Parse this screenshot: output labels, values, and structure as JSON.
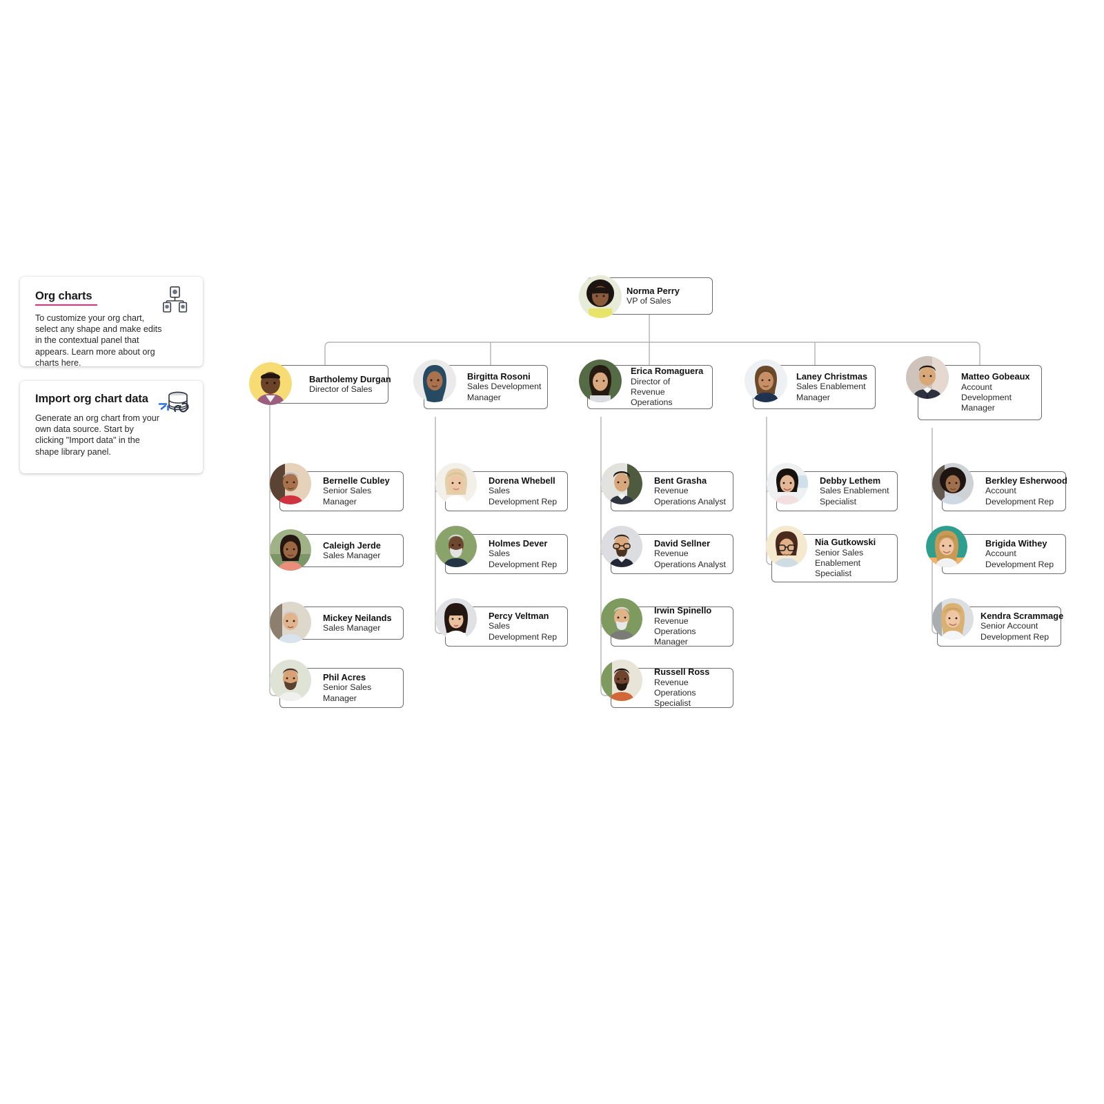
{
  "panel": {
    "cards": [
      {
        "id": "org-charts",
        "title": "Org charts",
        "body": "To customize your org chart, select any shape and make edits in the contextual panel that appears. Learn more about org charts here.",
        "icon": "org-chart-icon"
      },
      {
        "id": "import-org-chart-data",
        "title": "Import org chart data",
        "body": "Generate an org chart from your own data source. Start by clicking \"Import data\" in the shape library panel.",
        "icon": "database-link-icon"
      }
    ],
    "accent_color": "#ec2b7b"
  },
  "chart_data": {
    "type": "diagram",
    "title": "Sales org chart",
    "node_border_color": "#6b6b6b",
    "connector_color": "#b4b4b4",
    "root": {
      "id": "norma-perry",
      "name": "Norma Perry",
      "title": "VP of Sales",
      "avatar": "woman-curly-dark-hair"
    },
    "columns": [
      {
        "manager": {
          "id": "bartholemy-durgan",
          "name": "Bartholemy Durgan",
          "title": "Director of Sales",
          "avatar": "man-yellow-bg"
        },
        "reports": [
          {
            "id": "bernelle-cubley",
            "name": "Bernelle Cubley",
            "title": "Senior Sales Manager",
            "avatar": "woman-grey-hair-red-top"
          },
          {
            "id": "caleigh-jerde",
            "name": "Caleigh Jerde",
            "title": "Sales Manager",
            "avatar": "woman-outdoors-pink-top"
          },
          {
            "id": "mickey-neilands",
            "name": "Mickey Neilands",
            "title": "Sales Manager",
            "avatar": "man-white-hair-blue-shirt"
          },
          {
            "id": "phil-acres",
            "name": "Phil Acres",
            "title": "Senior Sales Manager",
            "avatar": "man-beard-white-shirt"
          }
        ]
      },
      {
        "manager": {
          "id": "birgitta-rosoni",
          "name": "Birgitta Rosoni",
          "title": "Sales Development Manager",
          "avatar": "woman-navy-hijab"
        },
        "reports": [
          {
            "id": "dorena-whebell",
            "name": "Dorena Whebell",
            "title": "Sales Development Rep",
            "avatar": "woman-blonde-bob"
          },
          {
            "id": "holmes-dever",
            "name": "Holmes Dever",
            "title": "Sales Development Rep",
            "avatar": "man-white-beard-navy"
          },
          {
            "id": "percy-veltman",
            "name": "Percy Veltman",
            "title": "Sales Development Rep",
            "avatar": "woman-dark-bangs"
          }
        ]
      },
      {
        "manager": {
          "id": "erica-romaguera",
          "name": "Erica Romaguera",
          "title": "Director of Revenue Operations",
          "avatar": "woman-dark-hair-green-bg"
        },
        "reports": [
          {
            "id": "bent-grasha",
            "name": "Bent Grasha",
            "title": "Revenue Operations Analyst",
            "avatar": "man-dark-hair-suit"
          },
          {
            "id": "david-sellner",
            "name": "David Sellner",
            "title": "Revenue Operations Analyst",
            "avatar": "man-glasses-beard-suit"
          },
          {
            "id": "irwin-spinello",
            "name": "Irwin Spinello",
            "title": "Revenue Operations Manager",
            "avatar": "man-grey-beard-outdoors"
          },
          {
            "id": "russell-ross",
            "name": "Russell Ross",
            "title": "Revenue Operations Specialist",
            "avatar": "man-orange-shirt"
          }
        ]
      },
      {
        "manager": {
          "id": "laney-christmas",
          "name": "Laney Christmas",
          "title": "Sales Enablement Manager",
          "avatar": "woman-navy-polo"
        },
        "reports": [
          {
            "id": "debby-lethem",
            "name": "Debby Lethem",
            "title": "Sales Enablement Specialist",
            "avatar": "woman-short-black-hair"
          },
          {
            "id": "nia-gutkowski",
            "name": "Nia Gutkowski",
            "title": "Senior Sales Enablement Specialist",
            "avatar": "woman-glasses-short-hair"
          }
        ]
      },
      {
        "manager": {
          "id": "matteo-gobeaux",
          "name": "Matteo Gobeaux",
          "title": "Account Development Manager",
          "avatar": "man-suit-tie"
        },
        "reports": [
          {
            "id": "berkley-esherwood",
            "name": "Berkley Esherwood",
            "title": "Account Development Rep",
            "avatar": "woman-afro-hair"
          },
          {
            "id": "brigida-withey",
            "name": "Brigida Withey",
            "title": "Account Development Rep",
            "avatar": "woman-blonde-teal-bg"
          },
          {
            "id": "kendra-scrammage",
            "name": "Kendra Scrammage",
            "title": "Senior Account Development Rep",
            "avatar": "woman-long-blonde-hair"
          }
        ]
      }
    ]
  }
}
